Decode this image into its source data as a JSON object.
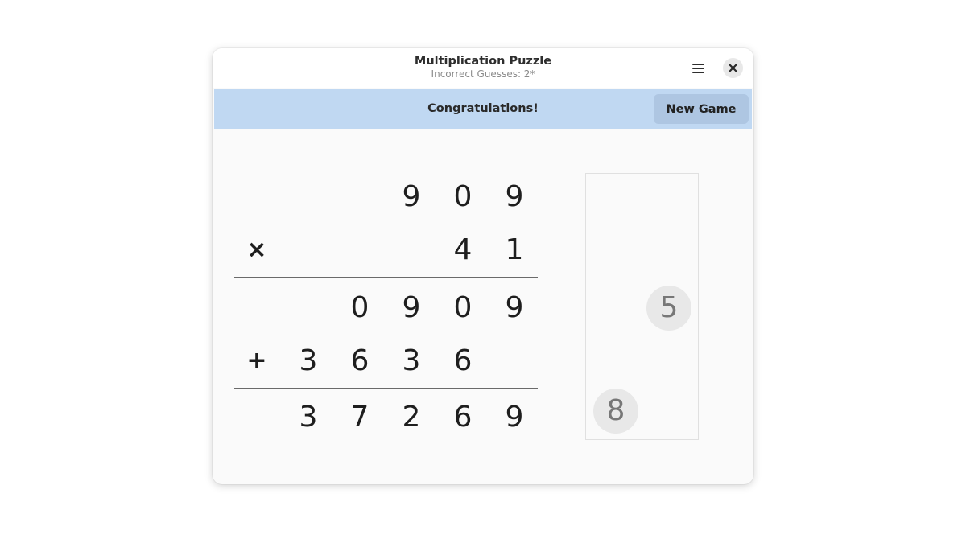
{
  "window": {
    "title": "Multiplication Puzzle",
    "subtitle": "Incorrect Guesses: 2*",
    "menu_icon": "hamburger-menu-icon",
    "close_icon": "close-icon"
  },
  "infobar": {
    "message": "Congratulations!",
    "new_game_label": "New Game",
    "background_color": "#c0d8f2"
  },
  "puzzle": {
    "multiplicand": [
      "9",
      "0",
      "9"
    ],
    "multiplier_operator": "×",
    "multiplier": [
      "4",
      "1"
    ],
    "partial_product_1": [
      "0",
      "9",
      "0",
      "9"
    ],
    "addition_operator": "+",
    "partial_product_2": [
      "3",
      "6",
      "3",
      "6"
    ],
    "result": [
      "3",
      "7",
      "2",
      "6",
      "9"
    ]
  },
  "tray": {
    "tiles": [
      "5",
      "8"
    ]
  }
}
